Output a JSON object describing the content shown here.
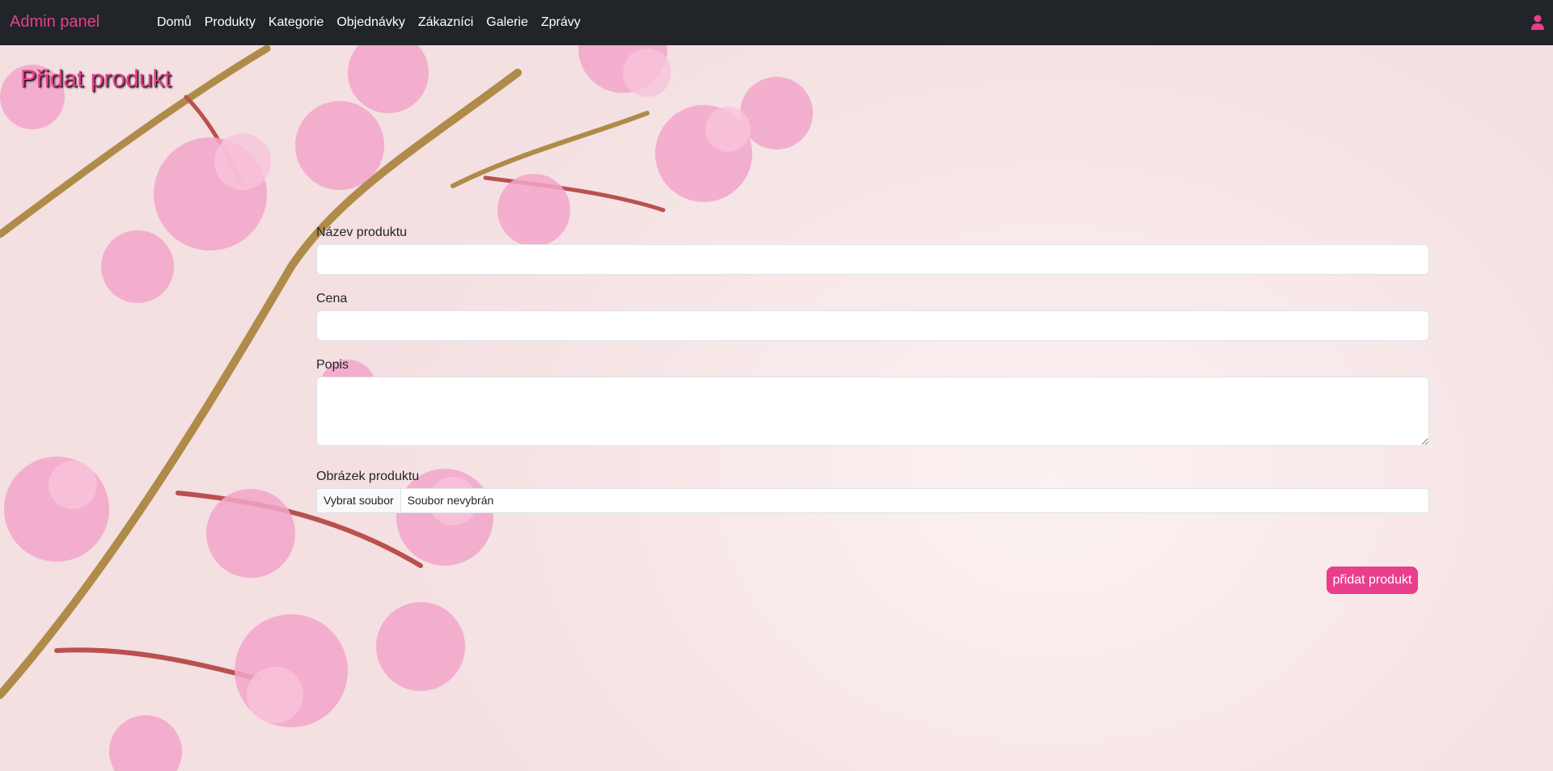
{
  "navbar": {
    "brand": "Admin panel",
    "links": [
      "Domů",
      "Produkty",
      "Kategorie",
      "Objednávky",
      "Zákazníci",
      "Galerie",
      "Zprávy"
    ],
    "user_icon": "user-icon"
  },
  "page": {
    "title": "Přidat produkt"
  },
  "form": {
    "name_label": "Název produktu",
    "name_value": "",
    "price_label": "Cena",
    "price_value": "",
    "description_label": "Popis",
    "description_value": "",
    "image_label": "Obrázek produktu",
    "file_button": "Vybrat soubor",
    "file_status": "Soubor nevybrán",
    "submit_label": "přidat produkt"
  },
  "colors": {
    "navbar_bg": "#212529",
    "accent": "#e83e8c",
    "background": "#f6eaea"
  }
}
